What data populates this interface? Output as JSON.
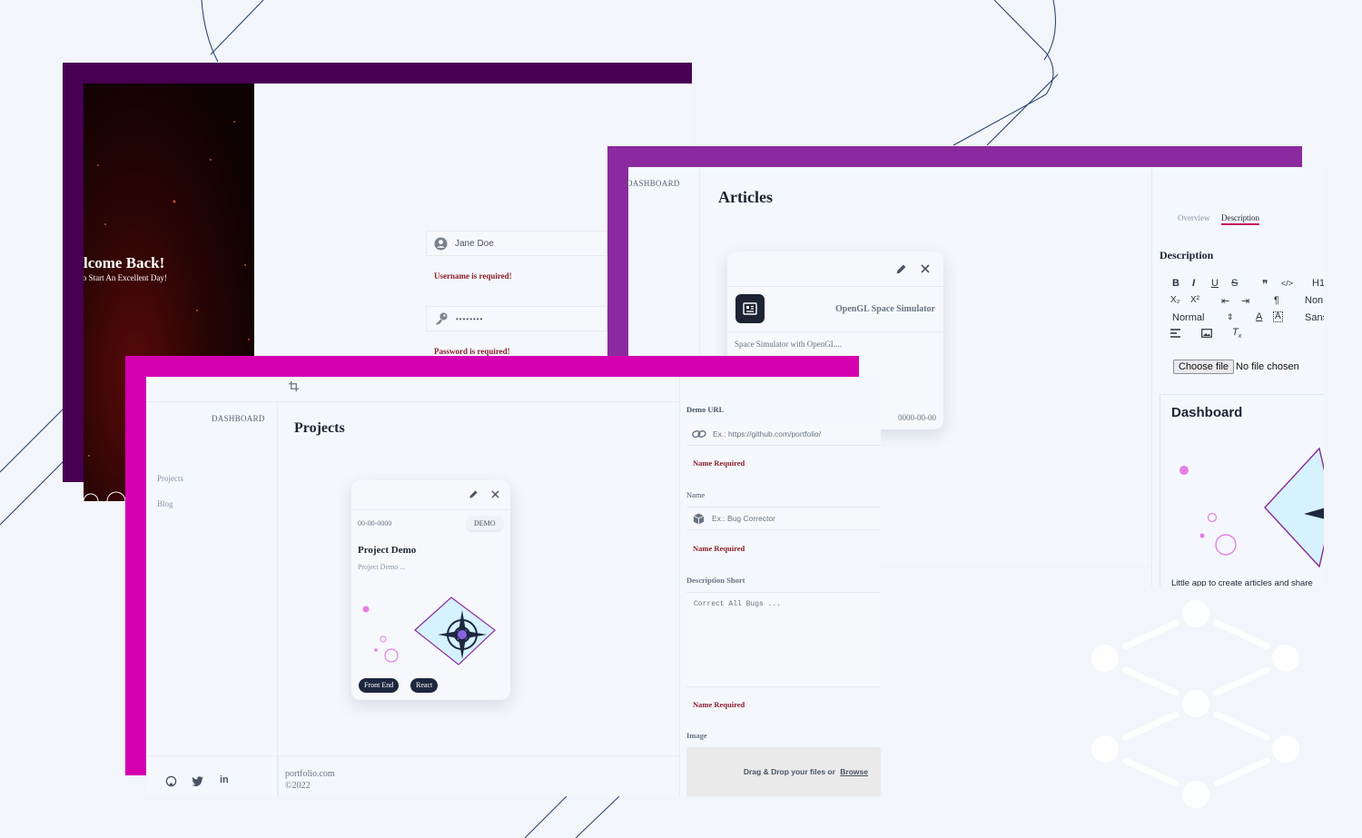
{
  "login": {
    "welcome_title": "lcome Back!",
    "welcome_subtitle": "To Start An Excellent Day!",
    "username_value": "Jane Doe",
    "username_error": "Username is required!",
    "password_value": "••••••••",
    "password_error": "Password is required!"
  },
  "articles": {
    "nav_dashboard": "DASHBOARD",
    "page_title": "Articles",
    "card_title": "OpenGL Space Simulator",
    "card_desc": "Space Simulator with OpenGL...",
    "card_date": "0000-00-00"
  },
  "description_panel": {
    "tab_overview": "Overview",
    "tab_description": "Description",
    "heading": "Description",
    "toolbar_row1": [
      "B",
      "I",
      "U",
      "S",
      "❞",
      "</>",
      "H1"
    ],
    "toolbar_row2": [
      "X₂",
      "X²",
      "⇤",
      "⇥",
      "¶",
      "Non"
    ],
    "toolbar_row3_select": "Normal",
    "toolbar_row3_extra": "Sans",
    "choose_file_label": "Choose file",
    "no_file_label": "No file chosen",
    "preview_title": "Dashboard",
    "preview_caption": "Little app to create articles and share"
  },
  "projects": {
    "nav_dashboard": "DASHBOARD",
    "nav_items": [
      "Projects",
      "Blog"
    ],
    "page_title": "Projects",
    "card_date": "00-00-0000",
    "card_demo": "DEMO",
    "card_title": "Project Demo",
    "card_desc": "Project Demo ...",
    "card_tags": [
      "Front End",
      "React"
    ],
    "footer_site": "portfolio.com",
    "footer_year": "©2022"
  },
  "form": {
    "demo_url_label": "Demo URL",
    "demo_url_placeholder": "Ex.: https://github.com/portfolio/",
    "demo_url_error": "Name Required",
    "name_label": "Name",
    "name_placeholder": "Ex.: Bug Corrector",
    "name_error": "Name Required",
    "desc_short_label": "Description Short",
    "desc_short_placeholder": "Correct All Bugs ...",
    "desc_short_error": "Name Required",
    "image_label": "Image",
    "dropzone_text": "Drag & Drop your files or ",
    "dropzone_link": "Browse"
  },
  "colors": {
    "frame_dark": "#470052",
    "frame_purple": "#8a2a9e",
    "frame_magenta": "#d400b0",
    "navy": "#1d2740",
    "error": "#8b1e2d"
  }
}
